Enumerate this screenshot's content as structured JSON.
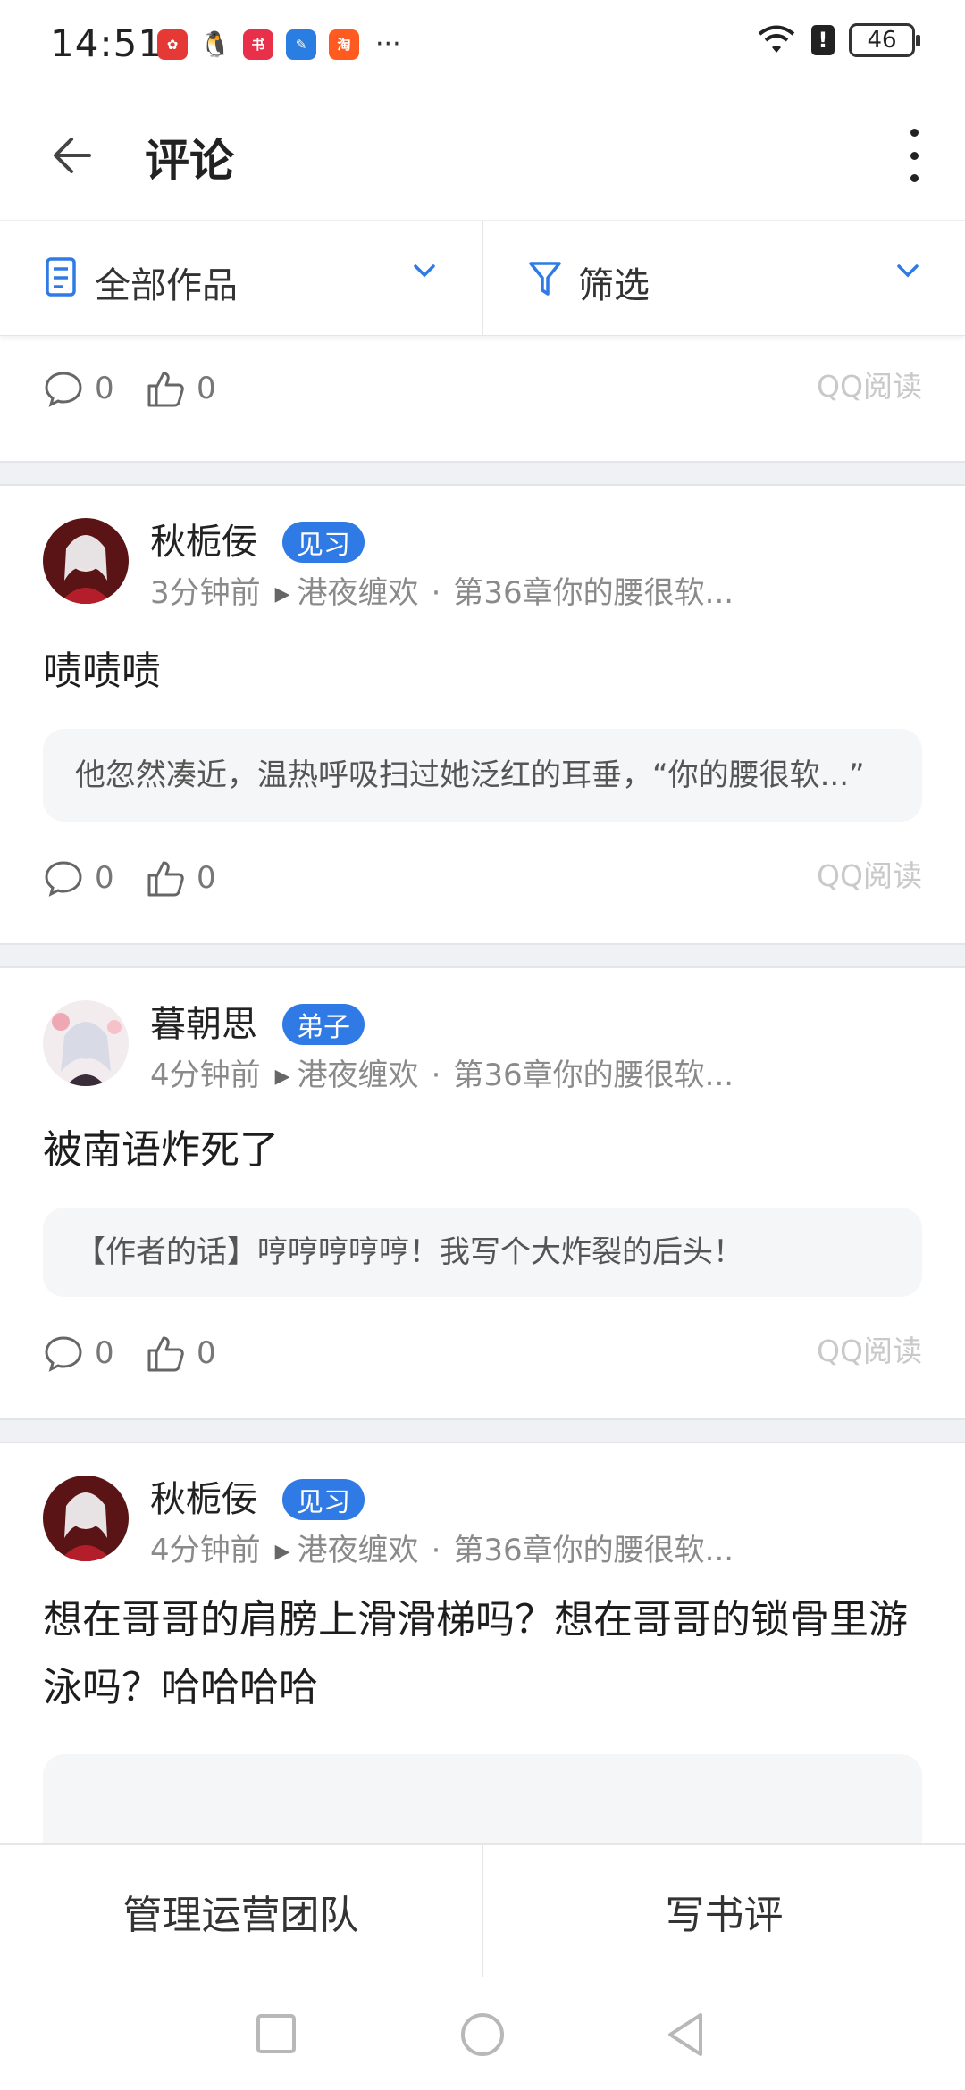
{
  "status": {
    "time": "14:51",
    "battery": "46",
    "dots": "···"
  },
  "header": {
    "title": "评论"
  },
  "filters": [
    {
      "label": "全部作品"
    },
    {
      "label": "筛选"
    }
  ],
  "source_label": "QQ阅读",
  "comments": [
    {
      "reply_count": "0",
      "like_count": "0"
    },
    {
      "user": "秋栀佞",
      "badge": "见习",
      "time": "3分钟前",
      "book": "港夜缠欢",
      "chapter": "第36章你的腰很软...",
      "text": "啧啧啧",
      "quote": "他忽然凑近，温热呼吸扫过她泛红的耳垂，“你的腰很软...”",
      "reply_count": "0",
      "like_count": "0"
    },
    {
      "user": "暮朝思",
      "badge": "弟子",
      "time": "4分钟前",
      "book": "港夜缠欢",
      "chapter": "第36章你的腰很软...",
      "text": "被南语炸死了",
      "quote": "【作者的话】哼哼哼哼哼！我写个大炸裂的后头！",
      "reply_count": "0",
      "like_count": "0"
    },
    {
      "user": "秋栀佞",
      "badge": "见习",
      "time": "4分钟前",
      "book": "港夜缠欢",
      "chapter": "第36章你的腰很软...",
      "text": "想在哥哥的肩膀上滑滑梯吗？想在哥哥的锁骨里游泳吗？哈哈哈哈"
    }
  ],
  "bottom": {
    "left": "管理运营团队",
    "right": "写书评"
  },
  "colors": {
    "accent": "#2f7ae5",
    "badge": "#2f7ae5"
  }
}
